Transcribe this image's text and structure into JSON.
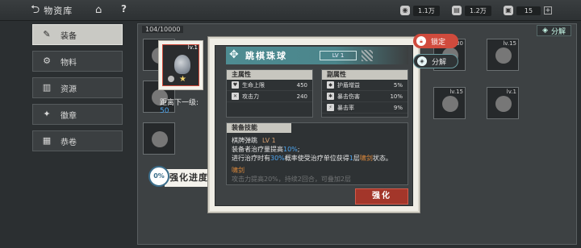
{
  "topbar": {
    "title": "物资库",
    "resources": [
      {
        "icon": "coin-icon",
        "value": "1.1万"
      },
      {
        "icon": "voucher-icon",
        "value": "1.2万"
      },
      {
        "icon": "gift-icon",
        "value": "15"
      }
    ]
  },
  "sidebar": {
    "items": [
      {
        "label": "装备",
        "icon": "equipment-icon",
        "active": true
      },
      {
        "label": "物料",
        "icon": "material-icon",
        "active": false
      },
      {
        "label": "资源",
        "icon": "resource-icon",
        "active": false
      },
      {
        "label": "徽章",
        "icon": "badge-icon",
        "active": false
      },
      {
        "label": "恭卷",
        "icon": "scroll-icon",
        "active": false
      }
    ]
  },
  "inventory": {
    "count": "104/10000",
    "decompose_label": "分解",
    "slot_levels": [
      "lv.30",
      "lv.15",
      "lv.15",
      "lv.1"
    ]
  },
  "item": {
    "level": "lv.1",
    "distance_label": "距离下一级:",
    "distance_value": "50",
    "progress_value": "0%",
    "progress_label": "强化进度"
  },
  "detail": {
    "name": "跳棋珠球",
    "level": "LV 1",
    "main_attr": {
      "header": "主属性",
      "rows": [
        {
          "name": "生命上限",
          "value": "450"
        },
        {
          "name": "攻击力",
          "value": "240"
        }
      ]
    },
    "sub_attr": {
      "header": "副属性",
      "rows": [
        {
          "name": "护盾增益",
          "value": "5%"
        },
        {
          "name": "暴击伤害",
          "value": "10%"
        },
        {
          "name": "暴击率",
          "value": "9%"
        }
      ]
    },
    "skill": {
      "header": "装备技能",
      "name": "棋牌弹跳",
      "level": "LV 1",
      "line1_a": "装备者治疗量提高",
      "line1_b": "10%",
      "line1_c": ";",
      "line2_a": "进行治疗时有",
      "line2_b": "30%",
      "line2_c": "概率使受治疗单位获得",
      "line2_d": "1",
      "line2_e": "层",
      "line2_f": "啸剑",
      "line2_g": "状态。",
      "sub_title": "啸剑",
      "faded_line": "攻击力提高20%，持续2回合，可叠加2层"
    },
    "enhance_label": "强化"
  },
  "actions": {
    "lock_label": "锁定",
    "decompose_label": "分解"
  }
}
